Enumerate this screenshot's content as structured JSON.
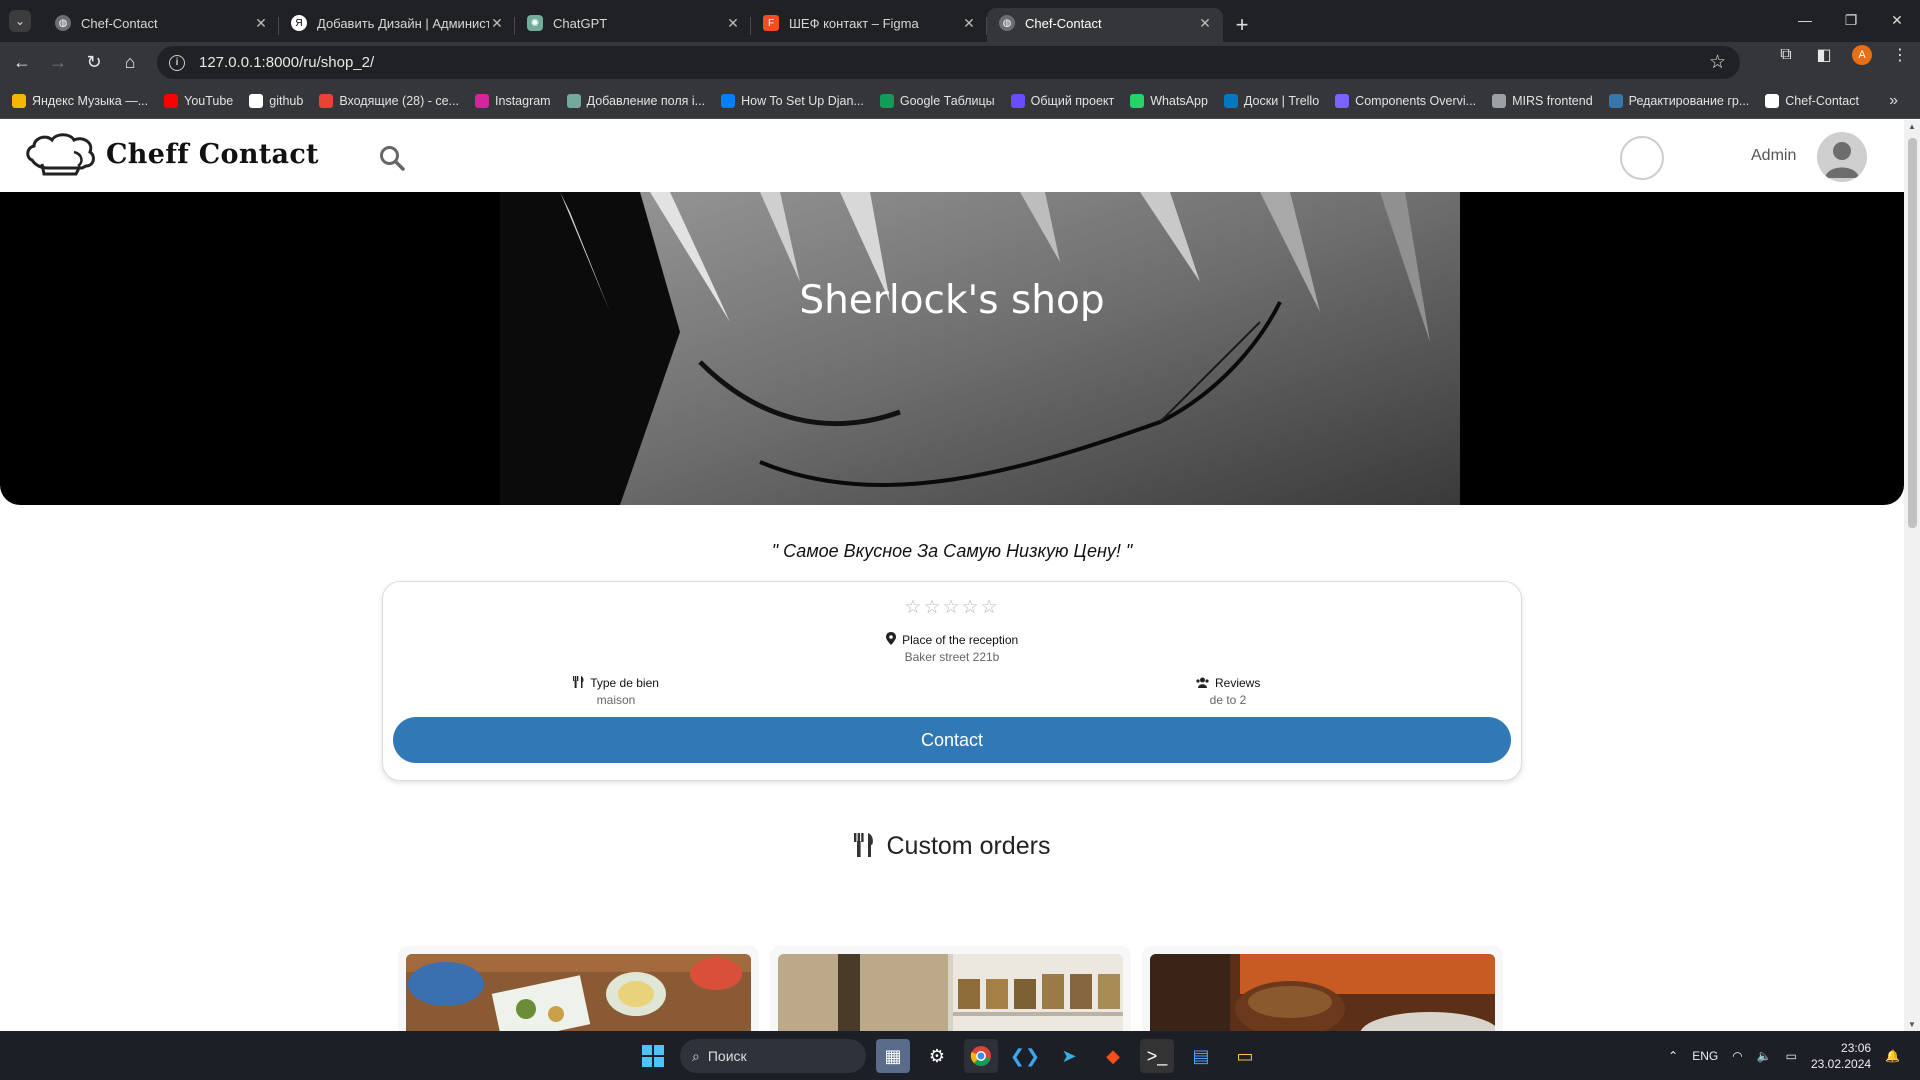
{
  "browser": {
    "tabs": [
      {
        "title": "Chef-Contact",
        "favicon": "globe-icon",
        "active": false
      },
      {
        "title": "Добавить Дизайн | Администр",
        "favicon": "yandex-icon",
        "active": false
      },
      {
        "title": "ChatGPT",
        "favicon": "chatgpt-icon",
        "active": false
      },
      {
        "title": "ШЕФ контакт – Figma",
        "favicon": "figma-icon",
        "active": false
      },
      {
        "title": "Chef-Contact",
        "favicon": "globe-icon",
        "active": true
      }
    ],
    "url": "127.0.0.1:8000/ru/shop_2/",
    "profile_initial": "A",
    "bookmarks": [
      {
        "label": "Яндекс Музыка —...",
        "icon": "yandex-music-icon",
        "color": "#f5b800"
      },
      {
        "label": "YouTube",
        "icon": "youtube-icon",
        "color": "#ff0000"
      },
      {
        "label": "github",
        "icon": "github-icon",
        "color": "#ffffff"
      },
      {
        "label": "Входящие (28) - се...",
        "icon": "gmail-icon",
        "color": "#ea4335"
      },
      {
        "label": "Instagram",
        "icon": "instagram-icon",
        "color": "#d6249f"
      },
      {
        "label": "Добавление поля i...",
        "icon": "chatgpt-icon",
        "color": "#74aa9c"
      },
      {
        "label": "How To Set Up Djan...",
        "icon": "digitalocean-icon",
        "color": "#0080ff"
      },
      {
        "label": "Google Таблицы",
        "icon": "sheets-icon",
        "color": "#0f9d58"
      },
      {
        "label": "Общий проект",
        "icon": "project-icon",
        "color": "#6c4cff"
      },
      {
        "label": "WhatsApp",
        "icon": "whatsapp-icon",
        "color": "#25d366"
      },
      {
        "label": "Доски | Trello",
        "icon": "trello-icon",
        "color": "#0079bf"
      },
      {
        "label": "Components Overvi...",
        "icon": "components-icon",
        "color": "#7b61ff"
      },
      {
        "label": "MIRS frontend",
        "icon": "globe-icon",
        "color": "#9aa0a6"
      },
      {
        "label": "Редактирование гр...",
        "icon": "python-icon",
        "color": "#3776ab"
      },
      {
        "label": "Chef-Contact",
        "icon": "github-icon",
        "color": "#ffffff"
      }
    ]
  },
  "site": {
    "logo_text": "Cheff Contact",
    "user_name": "Admin"
  },
  "shop": {
    "title": "Sherlock's shop",
    "slogan": "\" Самое Вкусное За Самую Низкую Цену! \"",
    "rating_stars": "☆☆☆☆☆",
    "place_label": "Place of the reception",
    "place_value": "Baker street 221b",
    "type_label": "Type de bien",
    "type_value": "maison",
    "reviews_label": "Reviews",
    "reviews_value": "de to 2",
    "contact_label": "Contact"
  },
  "orders": {
    "title": "Custom orders",
    "items": [
      {
        "image": "food-table-photo",
        "color": "#8a5a34"
      },
      {
        "image": "spice-jars-photo",
        "color": "#bca98a"
      },
      {
        "image": "soup-bowl-photo",
        "color": "#5c3018"
      }
    ]
  },
  "taskbar": {
    "search_placeholder": "Поиск",
    "language": "ENG",
    "time": "23:06",
    "date": "23.02.2024"
  },
  "colors": {
    "accent": "#3178b6",
    "chrome_dark": "#202124",
    "chrome_mid": "#35363a"
  }
}
